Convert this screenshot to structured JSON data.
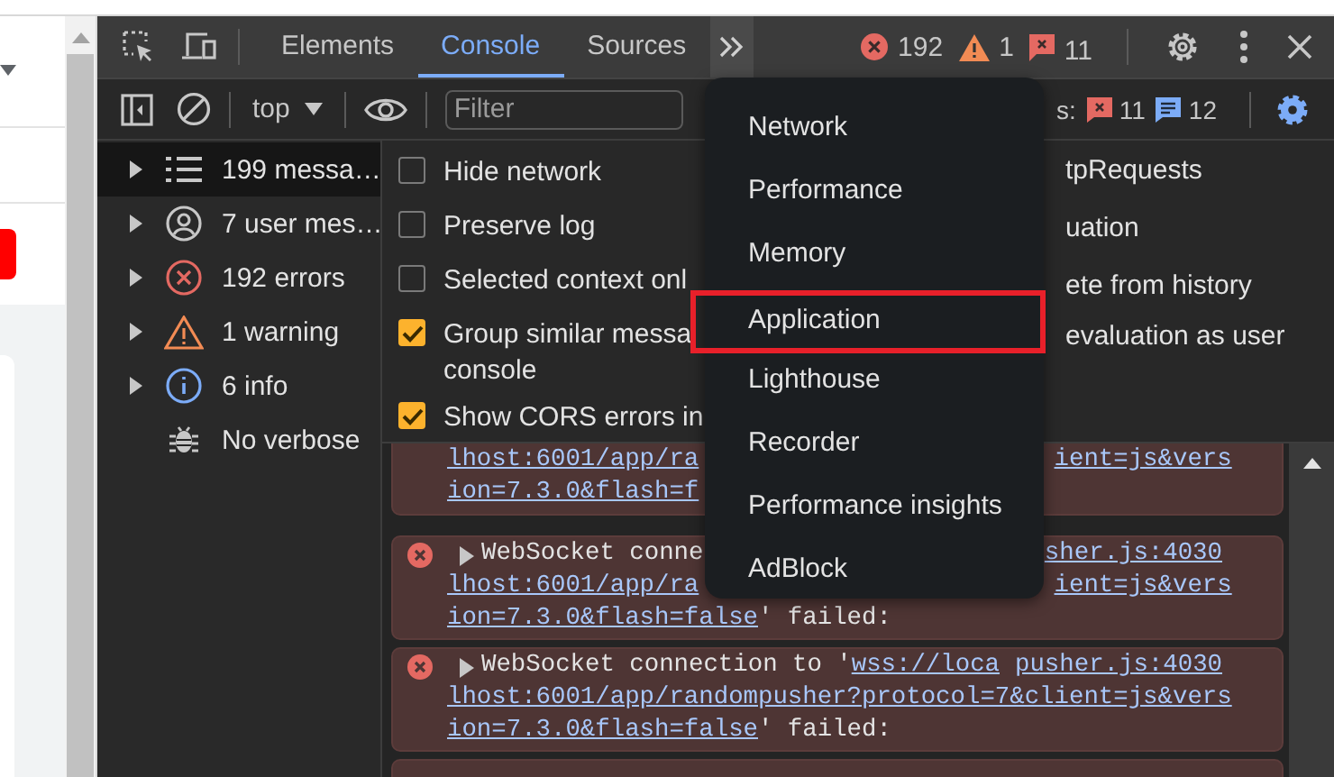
{
  "tabs": [
    {
      "label": "Elements",
      "selected": false
    },
    {
      "label": "Console",
      "selected": true
    },
    {
      "label": "Sources",
      "selected": false
    }
  ],
  "counters": {
    "errors": "192",
    "warnings": "1",
    "issues": "11"
  },
  "toolbar": {
    "context": "top",
    "filter": {
      "placeholder": "Filter"
    },
    "issues_label": "s:",
    "issue_errors": "11",
    "issue_messages": "12"
  },
  "sidebar": {
    "items": [
      {
        "kind": "messages",
        "label": "199 messa…",
        "selected": true,
        "expandable": true
      },
      {
        "kind": "user",
        "label": "7 user mes…",
        "selected": false,
        "expandable": true
      },
      {
        "kind": "errors",
        "label": "192 errors",
        "selected": false,
        "expandable": true
      },
      {
        "kind": "warnings",
        "label": "1 warning",
        "selected": false,
        "expandable": true
      },
      {
        "kind": "info",
        "label": "6 info",
        "selected": false,
        "expandable": true
      },
      {
        "kind": "verbose",
        "label": "No verbose",
        "selected": false,
        "expandable": false
      }
    ]
  },
  "settings": {
    "left": [
      {
        "label": "Hide network",
        "checked": false
      },
      {
        "label": "Preserve log",
        "checked": false
      },
      {
        "label": "Selected context onl",
        "checked": false
      },
      {
        "label": "Group similar messa",
        "label_2": "console",
        "checked": true
      },
      {
        "label": "Show CORS errors in",
        "checked": true
      }
    ],
    "right": [
      "tpRequests",
      "uation",
      "ete from history",
      "evaluation as user"
    ]
  },
  "messages": [
    {
      "lines": [
        {
          "left": "lhost:6001/app/ra",
          "right": "ient=js&vers"
        },
        {
          "left": "ion=7.3.0&flash=f"
        }
      ]
    },
    {
      "first": {
        "text": "WebSocket conne",
        "source": "sher.js:4030"
      },
      "lines": [
        {
          "left": "lhost:6001/app/ra",
          "right": "ient=js&vers"
        },
        {
          "left": "ion=7.3.0&flash=false",
          "after": "' failed:"
        }
      ]
    },
    {
      "first": {
        "text": "WebSocket connection to '",
        "link": "wss://loca",
        "source": "pusher.js:4030"
      },
      "lines": [
        {
          "left": "lhost:6001/app/randompusher?protocol=7&client=js&vers"
        },
        {
          "left": "ion=7.3.0&flash=false",
          "after": "' failed:"
        }
      ]
    }
  ],
  "menu": {
    "items": [
      {
        "label": "Network",
        "highlighted": false
      },
      {
        "label": "Performance",
        "highlighted": false
      },
      {
        "label": "Memory",
        "highlighted": false
      },
      {
        "label": "Application",
        "highlighted": true
      },
      {
        "label": "Lighthouse",
        "highlighted": false
      },
      {
        "label": "Recorder",
        "highlighted": false
      },
      {
        "label": "Performance insights",
        "highlighted": false
      },
      {
        "label": "AdBlock",
        "highlighted": false
      }
    ]
  }
}
